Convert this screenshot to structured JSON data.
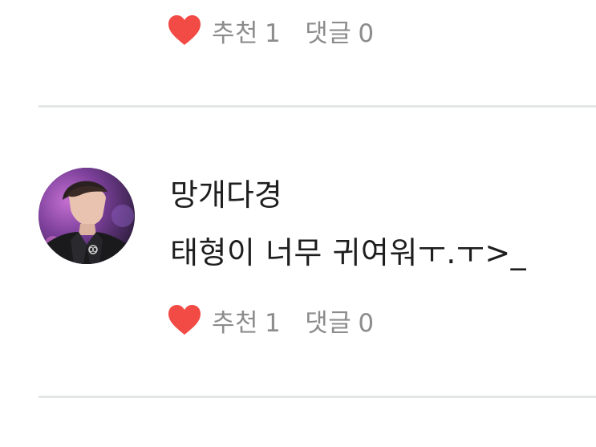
{
  "comments": [
    {
      "like_label": "추천",
      "like_count": "1",
      "reply_label": "댓글",
      "reply_count": "0"
    },
    {
      "author": "망개다경",
      "text": "태형이 너무 귀여워ㅜ.ㅜ>_",
      "like_label": "추천",
      "like_count": "1",
      "reply_label": "댓글",
      "reply_count": "0"
    }
  ],
  "colors": {
    "heart": "#f24a44",
    "muted_text": "#8c8c8c",
    "divider": "#e4e6e6"
  },
  "icons": {
    "like": "heart-icon"
  }
}
